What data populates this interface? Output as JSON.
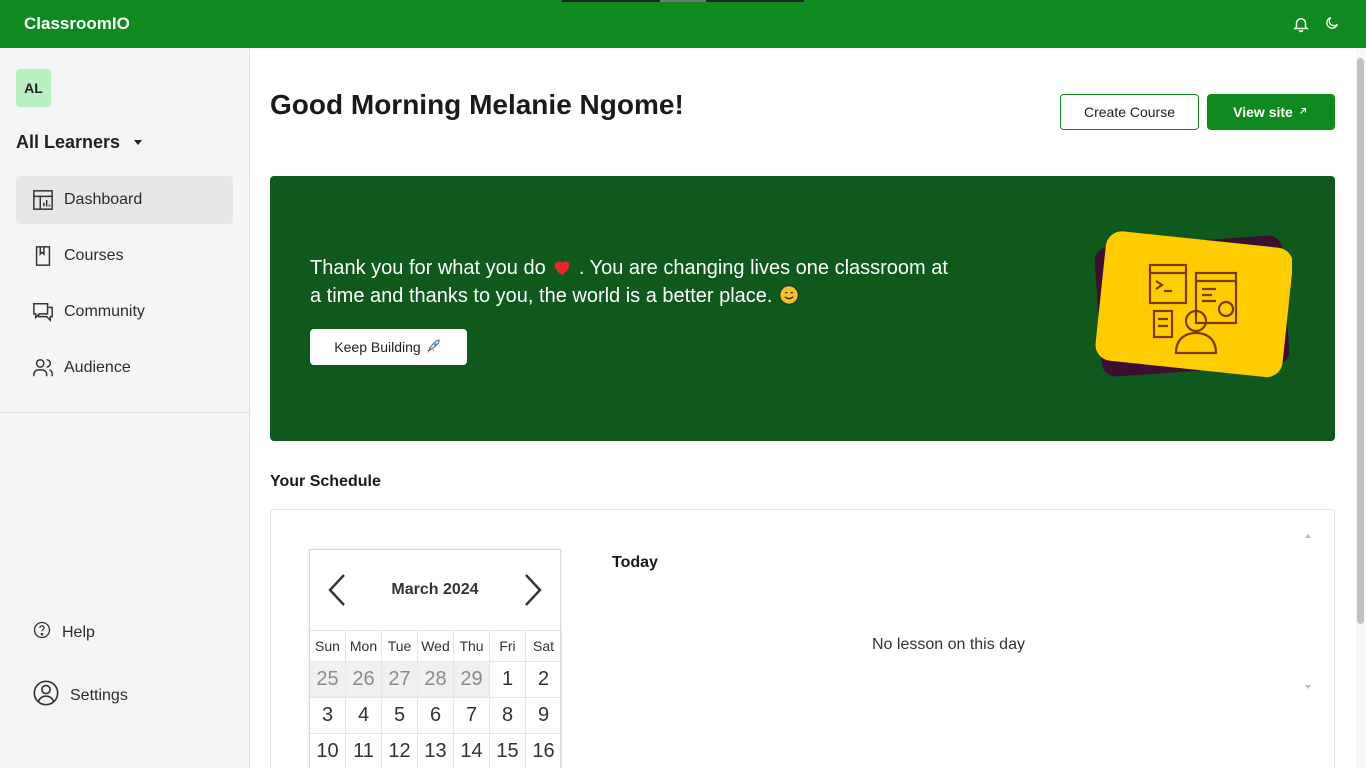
{
  "topbar": {
    "brand": "ClassroomIO",
    "icons": [
      "bell-icon",
      "moon-icon"
    ]
  },
  "sidebar": {
    "avatar_initials": "AL",
    "org_name": "All Learners",
    "items": [
      {
        "label": "Dashboard",
        "icon": "dashboard-icon",
        "active": true
      },
      {
        "label": "Courses",
        "icon": "book-icon",
        "active": false
      },
      {
        "label": "Community",
        "icon": "chat-icon",
        "active": false
      },
      {
        "label": "Audience",
        "icon": "users-icon",
        "active": false
      }
    ],
    "bottom": {
      "help": "Help",
      "settings": "Settings"
    }
  },
  "main": {
    "greeting": "Good Morning Melanie Ngome!",
    "create_course_label": "Create Course",
    "view_site_label": "View site",
    "banner": {
      "text_before_heart": "Thank you for what you do",
      "text_after_heart": ". You are changing lives one classroom at a time and thanks to you, the world is a better place.",
      "button_label": "Keep Building"
    },
    "schedule": {
      "title": "Your Schedule",
      "month": "March 2024",
      "days_of_week": [
        "Sun",
        "Mon",
        "Tue",
        "Wed",
        "Thu",
        "Fri",
        "Sat"
      ],
      "weeks": [
        [
          "25",
          "26",
          "27",
          "28",
          "29",
          "1",
          "2"
        ],
        [
          "3",
          "4",
          "5",
          "6",
          "7",
          "8",
          "9"
        ],
        [
          "10",
          "11",
          "12",
          "13",
          "14",
          "15",
          "16"
        ]
      ],
      "today_label": "Today",
      "empty_message": "No lesson on this day"
    }
  },
  "colors": {
    "brand": "#0e8a1f",
    "banner": "#10591c",
    "illustration": "#ffcc00",
    "illustration_back": "#3b0f30"
  }
}
